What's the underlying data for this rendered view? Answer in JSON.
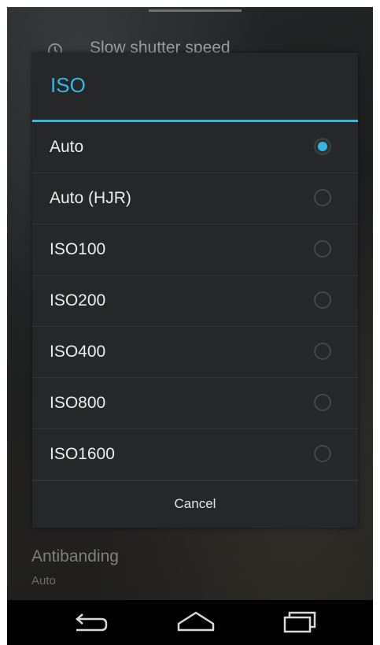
{
  "background": {
    "row_title": "Slow shutter speed",
    "antibanding_title": "Antibanding",
    "antibanding_value": "Auto"
  },
  "dialog": {
    "title": "ISO",
    "options": [
      {
        "label": "Auto",
        "checked": true
      },
      {
        "label": "Auto (HJR)",
        "checked": false
      },
      {
        "label": "ISO100",
        "checked": false
      },
      {
        "label": "ISO200",
        "checked": false
      },
      {
        "label": "ISO400",
        "checked": false
      },
      {
        "label": "ISO800",
        "checked": false
      },
      {
        "label": "ISO1600",
        "checked": false
      }
    ],
    "cancel_label": "Cancel"
  },
  "colors": {
    "accent": "#33b5e5",
    "dialog_bg": "#262728",
    "nav_bar": "#000000"
  },
  "nav_bar": {
    "icons": [
      "back-icon",
      "home-icon",
      "recents-icon"
    ]
  }
}
